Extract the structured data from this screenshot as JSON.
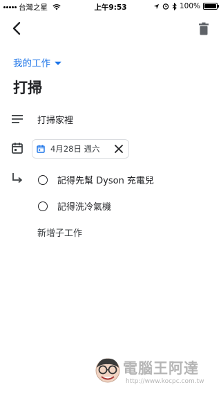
{
  "status_bar": {
    "carrier": "台灣之星",
    "time": "上午9:53",
    "battery": "100%",
    "battery_level": 1.0
  },
  "app_bar": {
    "back_icon": "chevron-left-icon",
    "delete_icon": "trash-icon"
  },
  "task": {
    "list_name": "我的工作",
    "title": "打掃",
    "details": "打掃家裡",
    "due_date": "4月28日 週六"
  },
  "subtasks": [
    {
      "title": "記得先幫 Dyson 充電兒"
    },
    {
      "title": "記得洗冷氣機"
    }
  ],
  "add_subtask_label": "新增子工作",
  "watermark": {
    "title": "電腦王阿達",
    "url": "http://www.kocpc.com.tw"
  },
  "colors": {
    "accent": "#1a73e8",
    "text": "#202124",
    "chip_border": "#dadce0"
  }
}
